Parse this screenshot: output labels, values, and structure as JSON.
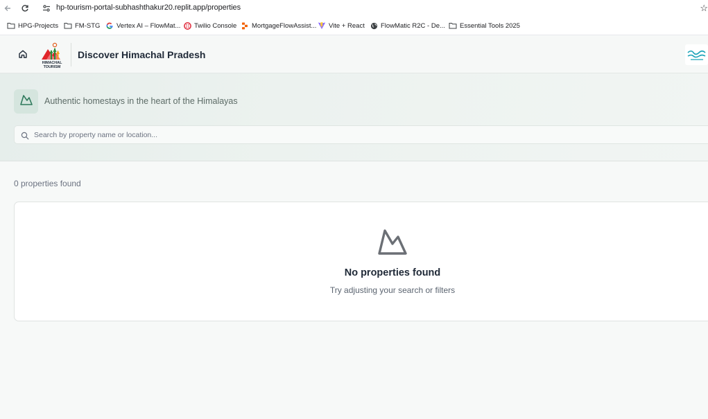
{
  "browser": {
    "url": "hp-tourism-portal-subhashthakur20.replit.app/properties",
    "bookmarks": [
      {
        "label": "HPG-Projects",
        "icon": "folder-icon"
      },
      {
        "label": "FM-STG",
        "icon": "folder-icon"
      },
      {
        "label": "Vertex AI – FlowMat...",
        "icon": "google-icon"
      },
      {
        "label": "Twilio Console",
        "icon": "twilio-icon"
      },
      {
        "label": "MortgageFlowAssist...",
        "icon": "replit-icon"
      },
      {
        "label": "Vite + React",
        "icon": "vite-icon"
      },
      {
        "label": "FlowMatic R2C - De...",
        "icon": "globe-icon"
      },
      {
        "label": "Essential Tools 2025",
        "icon": "folder-icon"
      }
    ]
  },
  "header": {
    "title": "Discover Himachal Pradesh",
    "logo_text": [
      "HIMACHAL",
      "TOURISM"
    ]
  },
  "hero": {
    "tagline": "Authentic homestays in the heart of the Himalayas",
    "search_placeholder": "Search by property name or location..."
  },
  "results": {
    "count_text": "0 properties found",
    "empty_title": "No properties found",
    "empty_subtitle": "Try adjusting your search or filters"
  },
  "colors": {
    "accent": "#2f7a5c",
    "hero_badge_bg": "#d5e5de"
  }
}
